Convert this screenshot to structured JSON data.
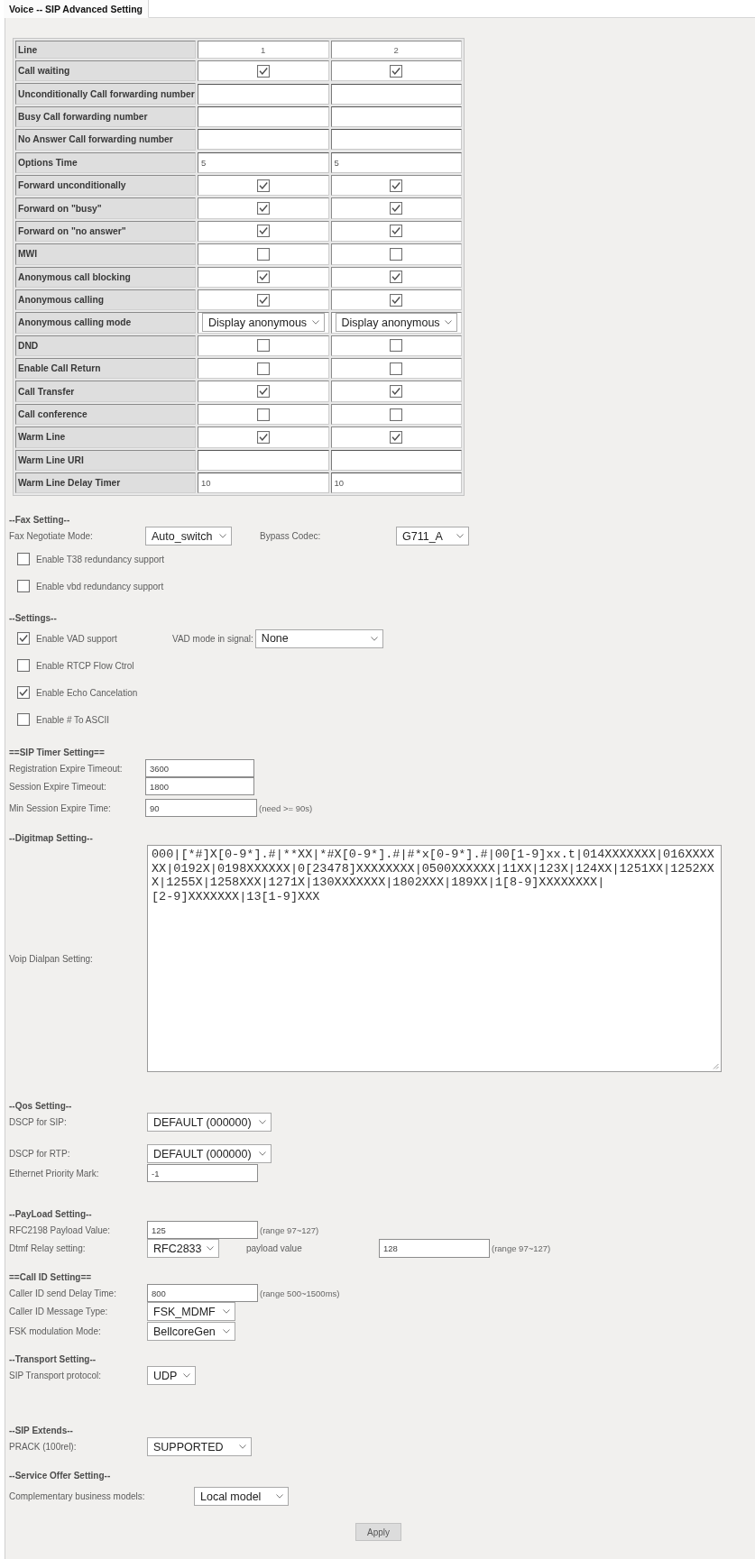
{
  "tab": {
    "label": "Voice -- SIP Advanced Setting",
    "selected": true
  },
  "line_table": {
    "header": {
      "label": "Line",
      "columns": [
        "1",
        "2"
      ]
    },
    "rows": [
      {
        "label": "Call waiting",
        "kind": "checkbox",
        "checked": [
          true,
          true
        ]
      },
      {
        "label": "Unconditionally Call forwarding number",
        "kind": "input"
      },
      {
        "label": "Busy Call forwarding number",
        "kind": "input"
      },
      {
        "label": "No Answer Call forwarding number",
        "kind": "input"
      },
      {
        "label": "Options Time",
        "kind": "input",
        "values": [
          "5",
          "5"
        ]
      },
      {
        "label": "Forward unconditionally",
        "kind": "checkbox",
        "checked": [
          true,
          true
        ]
      },
      {
        "label": "Forward on \"busy\"",
        "kind": "checkbox",
        "checked": [
          true,
          true
        ]
      },
      {
        "label": "Forward on \"no answer\"",
        "kind": "checkbox",
        "checked": [
          true,
          true
        ]
      },
      {
        "label": "MWI",
        "kind": "checkbox",
        "checked": [
          false,
          false
        ]
      },
      {
        "label": "Anonymous call blocking",
        "kind": "checkbox",
        "checked": [
          true,
          true
        ]
      },
      {
        "label": "Anonymous calling",
        "kind": "checkbox",
        "checked": [
          true,
          true
        ]
      },
      {
        "label": "Anonymous calling mode",
        "kind": "select",
        "values": [
          "Display anonymous",
          "Display anonymous"
        ]
      },
      {
        "label": "DND",
        "kind": "checkbox",
        "checked": [
          false,
          false
        ]
      },
      {
        "label": "Enable Call Return",
        "kind": "checkbox",
        "checked": [
          false,
          false
        ]
      },
      {
        "label": "Call Transfer",
        "kind": "checkbox",
        "checked": [
          true,
          true
        ]
      },
      {
        "label": "Call conference",
        "kind": "checkbox",
        "checked": [
          false,
          false
        ]
      },
      {
        "label": "Warm Line",
        "kind": "checkbox",
        "checked": [
          true,
          true
        ]
      },
      {
        "label": "Warm Line URI",
        "kind": "input"
      },
      {
        "label": "Warm Line Delay Timer",
        "kind": "input",
        "values": [
          "10",
          "10"
        ]
      }
    ]
  },
  "fax_setting": {
    "title": "--Fax Setting--",
    "negotiate_mode": {
      "label": "Fax Negotiate Mode:",
      "value": "Auto_switch"
    },
    "bypass_codec": {
      "label": "Bypass Codec:",
      "value": "G711_A"
    },
    "options": [
      {
        "label": "Enable T38 redundancy support",
        "checked": false
      },
      {
        "label": "Enable vbd redundancy support",
        "checked": false
      }
    ]
  },
  "settings": {
    "title": "--Settings--",
    "options": [
      {
        "label": "Enable VAD support",
        "checked": true
      },
      {
        "label": "Enable RTCP Flow Ctrol",
        "checked": false
      },
      {
        "label": "Enable Echo Cancelation",
        "checked": true
      },
      {
        "label": "Enable # To ASCII",
        "checked": false
      }
    ],
    "vad_mode": {
      "label": "VAD mode in signal:",
      "value": "None"
    }
  },
  "sip_timer_setting": {
    "title": "==SIP Timer Setting==",
    "rows": [
      {
        "label": "Registration Expire Timeout:",
        "kind": "input",
        "value": "3600"
      },
      {
        "label": "Session Expire Timeout:",
        "kind": "input",
        "value": "1800"
      },
      {
        "label": "Min Session Expire Time:",
        "kind": "input",
        "value": "90",
        "hint": "(need >= 90s)"
      }
    ]
  },
  "digitmap_setting": {
    "title": "--Digitmap Setting--",
    "label": "Voip Dialpan Setting:",
    "lines": [
      "000|[*#]X[0-9*].#|**XX|*#X[0-9*].#|#*x[0-9*].#|00[1-9]xx.t|014XXXXXXX|016XXXX",
      "XX|0192X|0198XXXXXX|0[23478]XXXXXXXX|0500XXXXXX|11XX|123X|124XX|1251XX|1252XX",
      "X|1255X|1258XXX|1271X|130XXXXXXX|1802XXX|189XX|1[8-9]XXXXXXXX|",
      "[2-9]XXXXXXX|13[1-9]XXX"
    ]
  },
  "qos_setting": {
    "title": "--Qos Setting--",
    "rows": [
      {
        "label": "DSCP for SIP:",
        "kind": "select",
        "value": "DEFAULT (000000)"
      },
      {
        "label": "DSCP for RTP:",
        "kind": "select",
        "value": "DEFAULT (000000)"
      },
      {
        "label": "Ethernet Priority Mark:",
        "kind": "input",
        "value": "-1"
      }
    ]
  },
  "payload_setting": {
    "title": "--PayLoad Setting--",
    "rows": [
      {
        "label": "RFC2198 Payload Value:",
        "kind": "input",
        "value": "125",
        "hint": "(range 97~127)"
      },
      {
        "label": "Dtmf Relay setting:",
        "kind": "select",
        "value": "RFC2833",
        "extra": {
          "label": "payload value",
          "kind": "input",
          "value": "128",
          "hint": "(range 97~127)"
        }
      }
    ]
  },
  "call_id_setting": {
    "title": "==Call ID Setting==",
    "rows": [
      {
        "label": "Caller ID send Delay Time:",
        "kind": "input",
        "value": "800",
        "hint": "(range 500~1500ms)"
      },
      {
        "label": "Caller ID Message Type:",
        "kind": "select",
        "value": "FSK_MDMF"
      },
      {
        "label": "FSK modulation Mode:",
        "kind": "select",
        "value": "BellcoreGen"
      }
    ]
  },
  "transport_setting": {
    "title": "--Transport Setting--",
    "rows": [
      {
        "label": "SIP Transport protocol:",
        "kind": "select",
        "value": "UDP"
      }
    ]
  },
  "sip_extends": {
    "title": "--SIP Extends--",
    "rows": [
      {
        "label": "PRACK (100rel):",
        "kind": "select",
        "value": "SUPPORTED"
      }
    ]
  },
  "service_offer_setting": {
    "title": "--Service Offer Setting--",
    "rows": [
      {
        "label": "Complementary business models:",
        "kind": "select",
        "value": "Local model"
      }
    ]
  },
  "apply_button": {
    "label": "Apply"
  }
}
